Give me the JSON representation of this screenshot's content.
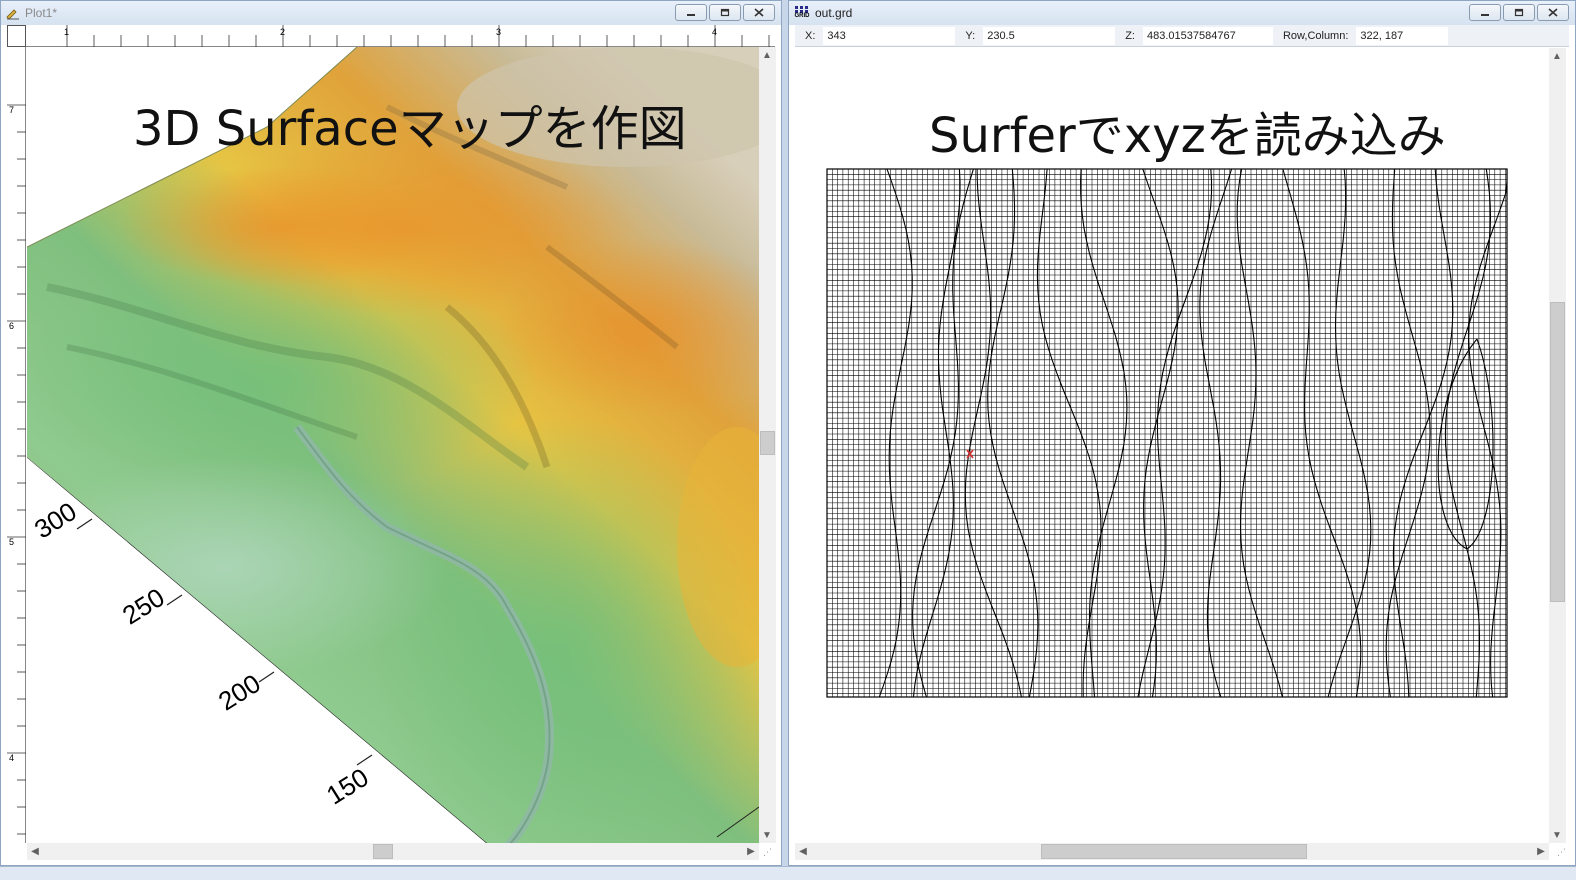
{
  "plot_window": {
    "title": "Plot1*",
    "ruler_numbers": [
      "1",
      "2",
      "3",
      "4"
    ],
    "vruler_numbers": [
      "7",
      "6",
      "5",
      "4"
    ],
    "heading": "3D Surfaceマップを作図",
    "axis_ticks": [
      "300",
      "250",
      "200",
      "150"
    ]
  },
  "grid_window": {
    "title": "out.grd",
    "icon_text": "GRID",
    "status": {
      "x_label": "X:",
      "x_value": "343",
      "y_label": "Y:",
      "y_value": "230.5",
      "z_label": "Z:",
      "z_value": "483.01537584767",
      "rc_label": "Row,Column:",
      "rc_value": "322, 187"
    },
    "heading": "Surferでxyzを読み込み"
  },
  "colors": {
    "terrain_low": "#7fbf84",
    "terrain_mid": "#9fcf8a",
    "terrain_high": "#e0a83a",
    "terrain_peak": "#cfc3a8",
    "grid_line": "#000000",
    "marker": "#d83030"
  }
}
